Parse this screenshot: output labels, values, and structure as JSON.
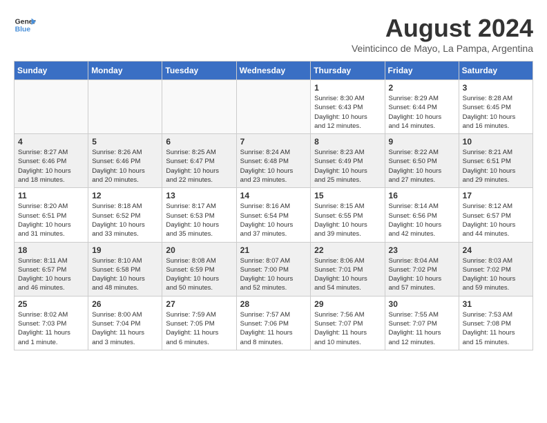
{
  "header": {
    "logo_line1": "General",
    "logo_line2": "Blue",
    "month_year": "August 2024",
    "location": "Veinticinco de Mayo, La Pampa, Argentina"
  },
  "days_of_week": [
    "Sunday",
    "Monday",
    "Tuesday",
    "Wednesday",
    "Thursday",
    "Friday",
    "Saturday"
  ],
  "weeks": [
    [
      {
        "day": "",
        "info": ""
      },
      {
        "day": "",
        "info": ""
      },
      {
        "day": "",
        "info": ""
      },
      {
        "day": "",
        "info": ""
      },
      {
        "day": "1",
        "info": "Sunrise: 8:30 AM\nSunset: 6:43 PM\nDaylight: 10 hours\nand 12 minutes."
      },
      {
        "day": "2",
        "info": "Sunrise: 8:29 AM\nSunset: 6:44 PM\nDaylight: 10 hours\nand 14 minutes."
      },
      {
        "day": "3",
        "info": "Sunrise: 8:28 AM\nSunset: 6:45 PM\nDaylight: 10 hours\nand 16 minutes."
      }
    ],
    [
      {
        "day": "4",
        "info": "Sunrise: 8:27 AM\nSunset: 6:46 PM\nDaylight: 10 hours\nand 18 minutes."
      },
      {
        "day": "5",
        "info": "Sunrise: 8:26 AM\nSunset: 6:46 PM\nDaylight: 10 hours\nand 20 minutes."
      },
      {
        "day": "6",
        "info": "Sunrise: 8:25 AM\nSunset: 6:47 PM\nDaylight: 10 hours\nand 22 minutes."
      },
      {
        "day": "7",
        "info": "Sunrise: 8:24 AM\nSunset: 6:48 PM\nDaylight: 10 hours\nand 23 minutes."
      },
      {
        "day": "8",
        "info": "Sunrise: 8:23 AM\nSunset: 6:49 PM\nDaylight: 10 hours\nand 25 minutes."
      },
      {
        "day": "9",
        "info": "Sunrise: 8:22 AM\nSunset: 6:50 PM\nDaylight: 10 hours\nand 27 minutes."
      },
      {
        "day": "10",
        "info": "Sunrise: 8:21 AM\nSunset: 6:51 PM\nDaylight: 10 hours\nand 29 minutes."
      }
    ],
    [
      {
        "day": "11",
        "info": "Sunrise: 8:20 AM\nSunset: 6:51 PM\nDaylight: 10 hours\nand 31 minutes."
      },
      {
        "day": "12",
        "info": "Sunrise: 8:18 AM\nSunset: 6:52 PM\nDaylight: 10 hours\nand 33 minutes."
      },
      {
        "day": "13",
        "info": "Sunrise: 8:17 AM\nSunset: 6:53 PM\nDaylight: 10 hours\nand 35 minutes."
      },
      {
        "day": "14",
        "info": "Sunrise: 8:16 AM\nSunset: 6:54 PM\nDaylight: 10 hours\nand 37 minutes."
      },
      {
        "day": "15",
        "info": "Sunrise: 8:15 AM\nSunset: 6:55 PM\nDaylight: 10 hours\nand 39 minutes."
      },
      {
        "day": "16",
        "info": "Sunrise: 8:14 AM\nSunset: 6:56 PM\nDaylight: 10 hours\nand 42 minutes."
      },
      {
        "day": "17",
        "info": "Sunrise: 8:12 AM\nSunset: 6:57 PM\nDaylight: 10 hours\nand 44 minutes."
      }
    ],
    [
      {
        "day": "18",
        "info": "Sunrise: 8:11 AM\nSunset: 6:57 PM\nDaylight: 10 hours\nand 46 minutes."
      },
      {
        "day": "19",
        "info": "Sunrise: 8:10 AM\nSunset: 6:58 PM\nDaylight: 10 hours\nand 48 minutes."
      },
      {
        "day": "20",
        "info": "Sunrise: 8:08 AM\nSunset: 6:59 PM\nDaylight: 10 hours\nand 50 minutes."
      },
      {
        "day": "21",
        "info": "Sunrise: 8:07 AM\nSunset: 7:00 PM\nDaylight: 10 hours\nand 52 minutes."
      },
      {
        "day": "22",
        "info": "Sunrise: 8:06 AM\nSunset: 7:01 PM\nDaylight: 10 hours\nand 54 minutes."
      },
      {
        "day": "23",
        "info": "Sunrise: 8:04 AM\nSunset: 7:02 PM\nDaylight: 10 hours\nand 57 minutes."
      },
      {
        "day": "24",
        "info": "Sunrise: 8:03 AM\nSunset: 7:02 PM\nDaylight: 10 hours\nand 59 minutes."
      }
    ],
    [
      {
        "day": "25",
        "info": "Sunrise: 8:02 AM\nSunset: 7:03 PM\nDaylight: 11 hours\nand 1 minute."
      },
      {
        "day": "26",
        "info": "Sunrise: 8:00 AM\nSunset: 7:04 PM\nDaylight: 11 hours\nand 3 minutes."
      },
      {
        "day": "27",
        "info": "Sunrise: 7:59 AM\nSunset: 7:05 PM\nDaylight: 11 hours\nand 6 minutes."
      },
      {
        "day": "28",
        "info": "Sunrise: 7:57 AM\nSunset: 7:06 PM\nDaylight: 11 hours\nand 8 minutes."
      },
      {
        "day": "29",
        "info": "Sunrise: 7:56 AM\nSunset: 7:07 PM\nDaylight: 11 hours\nand 10 minutes."
      },
      {
        "day": "30",
        "info": "Sunrise: 7:55 AM\nSunset: 7:07 PM\nDaylight: 11 hours\nand 12 minutes."
      },
      {
        "day": "31",
        "info": "Sunrise: 7:53 AM\nSunset: 7:08 PM\nDaylight: 11 hours\nand 15 minutes."
      }
    ]
  ]
}
